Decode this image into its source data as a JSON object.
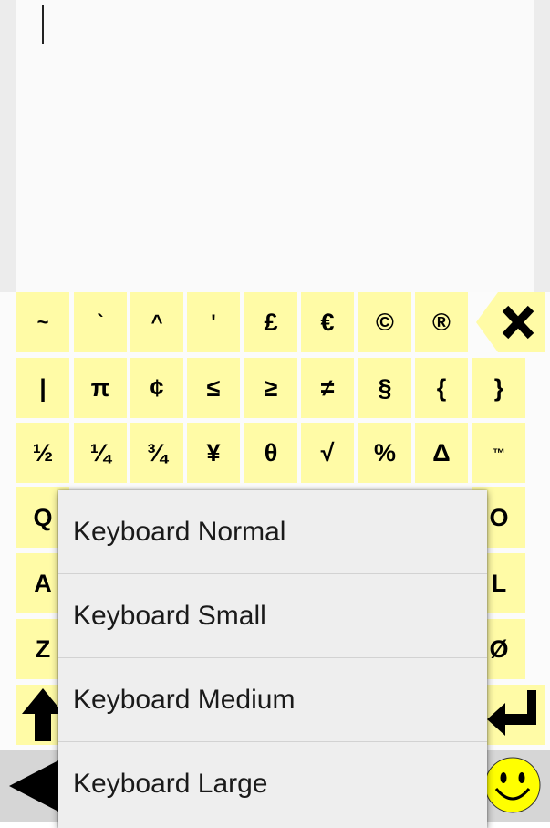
{
  "keyboard": {
    "row1": [
      "~",
      "`",
      "^",
      "'",
      "£",
      "€",
      "©",
      "®"
    ],
    "row2": [
      "|",
      "π",
      "¢",
      "≤",
      "≥",
      "≠",
      "§",
      "{",
      "}"
    ],
    "row3": [
      "½",
      "¼",
      "¾",
      "¥",
      "θ",
      "√",
      "%",
      "Δ",
      "™"
    ],
    "row4": {
      "left": "Q",
      "right": "O"
    },
    "row5": {
      "left": "A",
      "right": "L"
    },
    "row6": {
      "left": "Z",
      "right": "Ø"
    }
  },
  "menu": {
    "items": [
      "Keyboard Normal",
      "Keyboard Small",
      "Keyboard Medium",
      "Keyboard Large"
    ]
  },
  "colors": {
    "key_bg": "#fffba6",
    "smiley": "#ffff00",
    "menu_bg": "#eeeeee"
  },
  "icons": [
    "backspace-icon",
    "shift-icon",
    "enter-icon",
    "left-arrow-icon",
    "smiley-icon"
  ]
}
